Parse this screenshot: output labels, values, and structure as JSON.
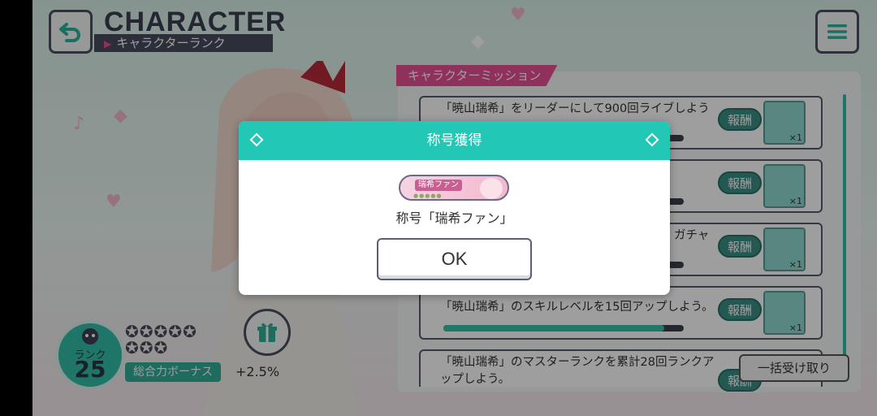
{
  "header": {
    "title": "CHARACTER",
    "subtitle": "キャラクターランク"
  },
  "missions": {
    "tab_label": "キャラクターミッション",
    "items": [
      {
        "text": "「暁山瑞希」をリーダーにして900回ライブしよう",
        "progress": 0.92,
        "reward_label": "報酬",
        "reward_count": "×1"
      },
      {
        "text": "",
        "progress": 0.92,
        "reward_label": "報酬",
        "reward_count": "×1"
      },
      {
        "text": "ガチャ",
        "progress": 0.92,
        "reward_label": "報酬",
        "reward_count": "×1"
      },
      {
        "text": "「暁山瑞希」のスキルレベルを15回アップしよう。",
        "progress": 0.92,
        "reward_label": "報酬",
        "reward_count": "×1"
      },
      {
        "text": "「暁山瑞希」のマスターランクを累計28回ランクアップしよう。",
        "progress": 0,
        "reward_label": "報酬",
        "reward_count": ""
      }
    ],
    "collect_all_label": "一括受け取り"
  },
  "rank": {
    "label": "ランク",
    "value": "25",
    "bonus_label": "総合力ボーナス",
    "bonus_value": "+2.5%",
    "filled_stars": 8
  },
  "modal": {
    "title": "称号獲得",
    "badge_text": "瑞希ファン",
    "message": "称号「瑞希ファン」",
    "ok_label": "OK"
  },
  "colors": {
    "accent_teal": "#23c7b5",
    "accent_pink": "#e94f93",
    "dark": "#484b5d"
  }
}
